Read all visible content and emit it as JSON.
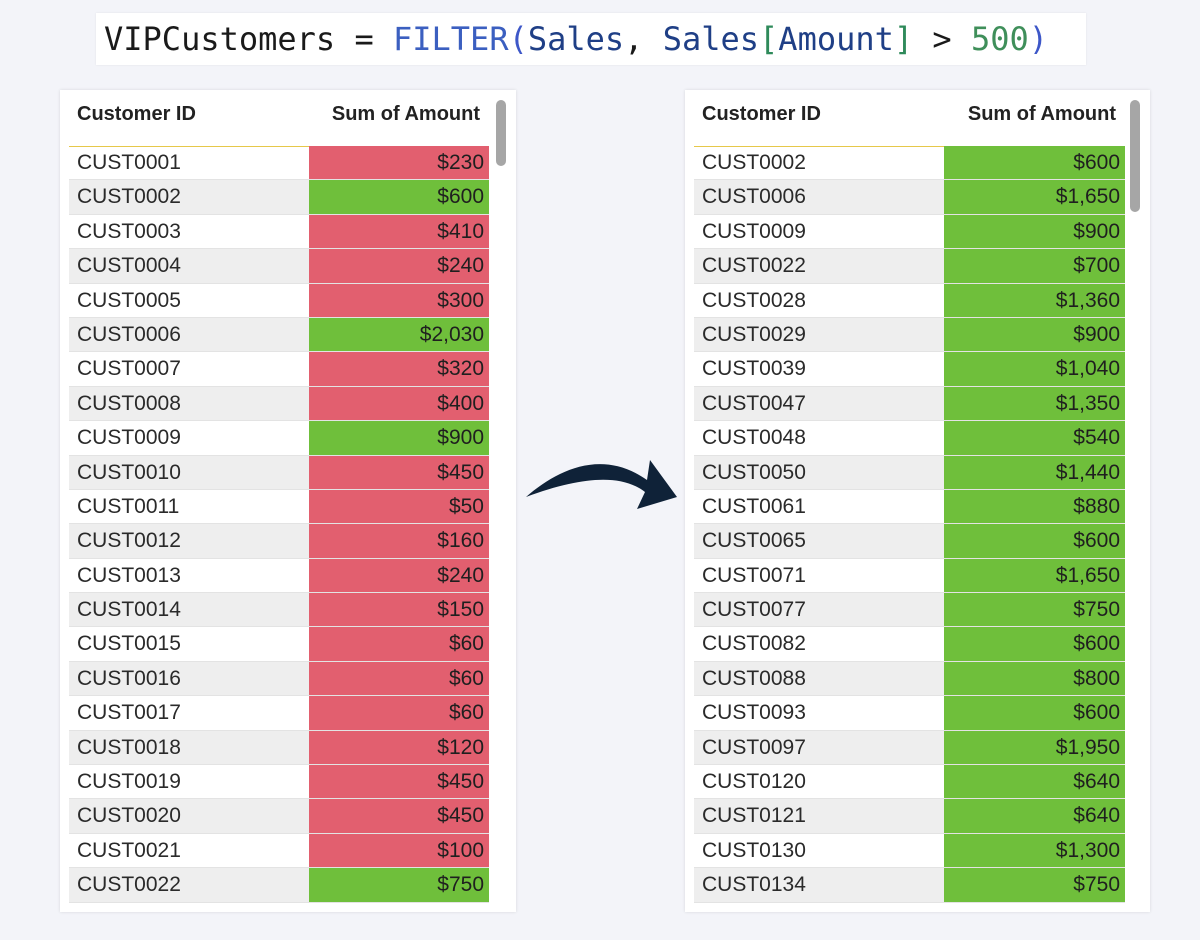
{
  "formula": {
    "var": "VIPCustomers",
    "eq": " = ",
    "fn": "FILTER",
    "open": "(",
    "table": "Sales",
    "comma": ", ",
    "table2": "Sales",
    "lbr": "[",
    "column": "Amount",
    "rbr": "]",
    "gt": " > ",
    "threshold": "500",
    "close": ")"
  },
  "colors": {
    "above": "#6fbf3b",
    "below": "#e25f6f",
    "arrow": "#0f2238"
  },
  "left_table": {
    "headers": {
      "id": "Customer ID",
      "amount": "Sum of Amount"
    },
    "rows": [
      {
        "id": "CUST0001",
        "amount": "$230",
        "status": "below"
      },
      {
        "id": "CUST0002",
        "amount": "$600",
        "status": "above"
      },
      {
        "id": "CUST0003",
        "amount": "$410",
        "status": "below"
      },
      {
        "id": "CUST0004",
        "amount": "$240",
        "status": "below"
      },
      {
        "id": "CUST0005",
        "amount": "$300",
        "status": "below"
      },
      {
        "id": "CUST0006",
        "amount": "$2,030",
        "status": "above"
      },
      {
        "id": "CUST0007",
        "amount": "$320",
        "status": "below"
      },
      {
        "id": "CUST0008",
        "amount": "$400",
        "status": "below"
      },
      {
        "id": "CUST0009",
        "amount": "$900",
        "status": "above"
      },
      {
        "id": "CUST0010",
        "amount": "$450",
        "status": "below"
      },
      {
        "id": "CUST0011",
        "amount": "$50",
        "status": "below"
      },
      {
        "id": "CUST0012",
        "amount": "$160",
        "status": "below"
      },
      {
        "id": "CUST0013",
        "amount": "$240",
        "status": "below"
      },
      {
        "id": "CUST0014",
        "amount": "$150",
        "status": "below"
      },
      {
        "id": "CUST0015",
        "amount": "$60",
        "status": "below"
      },
      {
        "id": "CUST0016",
        "amount": "$60",
        "status": "below"
      },
      {
        "id": "CUST0017",
        "amount": "$60",
        "status": "below"
      },
      {
        "id": "CUST0018",
        "amount": "$120",
        "status": "below"
      },
      {
        "id": "CUST0019",
        "amount": "$450",
        "status": "below"
      },
      {
        "id": "CUST0020",
        "amount": "$450",
        "status": "below"
      },
      {
        "id": "CUST0021",
        "amount": "$100",
        "status": "below"
      },
      {
        "id": "CUST0022",
        "amount": "$750",
        "status": "above"
      }
    ]
  },
  "right_table": {
    "headers": {
      "id": "Customer ID",
      "amount": "Sum of Amount"
    },
    "rows": [
      {
        "id": "CUST0002",
        "amount": "$600",
        "status": "above"
      },
      {
        "id": "CUST0006",
        "amount": "$1,650",
        "status": "above"
      },
      {
        "id": "CUST0009",
        "amount": "$900",
        "status": "above"
      },
      {
        "id": "CUST0022",
        "amount": "$700",
        "status": "above"
      },
      {
        "id": "CUST0028",
        "amount": "$1,360",
        "status": "above"
      },
      {
        "id": "CUST0029",
        "amount": "$900",
        "status": "above"
      },
      {
        "id": "CUST0039",
        "amount": "$1,040",
        "status": "above"
      },
      {
        "id": "CUST0047",
        "amount": "$1,350",
        "status": "above"
      },
      {
        "id": "CUST0048",
        "amount": "$540",
        "status": "above"
      },
      {
        "id": "CUST0050",
        "amount": "$1,440",
        "status": "above"
      },
      {
        "id": "CUST0061",
        "amount": "$880",
        "status": "above"
      },
      {
        "id": "CUST0065",
        "amount": "$600",
        "status": "above"
      },
      {
        "id": "CUST0071",
        "amount": "$1,650",
        "status": "above"
      },
      {
        "id": "CUST0077",
        "amount": "$750",
        "status": "above"
      },
      {
        "id": "CUST0082",
        "amount": "$600",
        "status": "above"
      },
      {
        "id": "CUST0088",
        "amount": "$800",
        "status": "above"
      },
      {
        "id": "CUST0093",
        "amount": "$600",
        "status": "above"
      },
      {
        "id": "CUST0097",
        "amount": "$1,950",
        "status": "above"
      },
      {
        "id": "CUST0120",
        "amount": "$640",
        "status": "above"
      },
      {
        "id": "CUST0121",
        "amount": "$640",
        "status": "above"
      },
      {
        "id": "CUST0130",
        "amount": "$1,300",
        "status": "above"
      },
      {
        "id": "CUST0134",
        "amount": "$750",
        "status": "above"
      }
    ]
  }
}
